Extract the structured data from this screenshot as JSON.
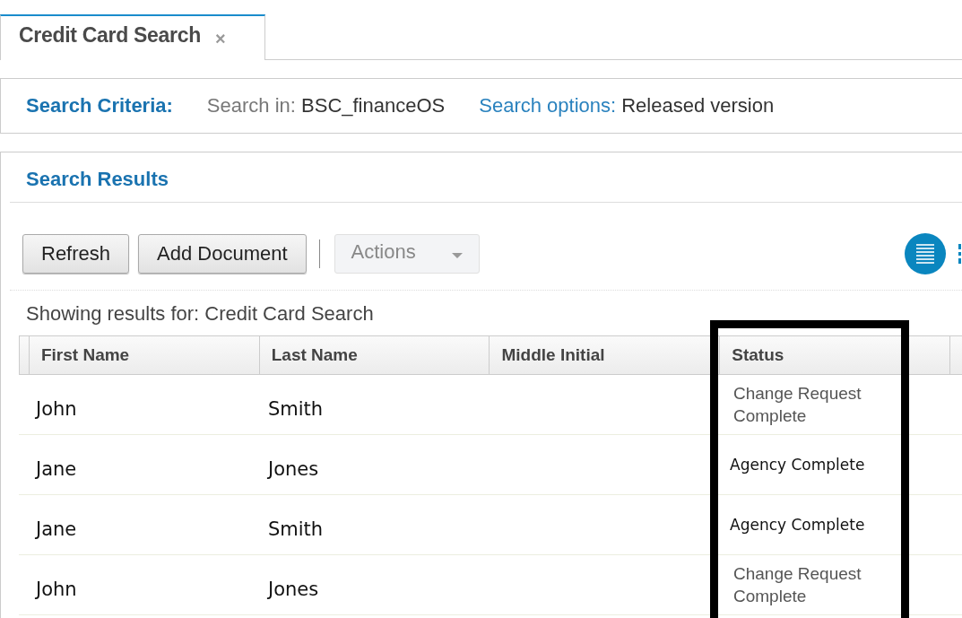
{
  "tabs": [
    {
      "label": "Credit Card Search",
      "selected": true,
      "close": "×"
    }
  ],
  "criteria": {
    "title": "Search Criteria:",
    "search_in_label": "Search in:",
    "search_in_value": "BSC_financeOS",
    "options_label": "Search options:",
    "options_value": "Released version"
  },
  "results": {
    "title": "Search Results",
    "toolbar": [
      {
        "kind": "button",
        "label": "Refresh",
        "disabled": false
      },
      {
        "kind": "button",
        "label": "Add Document",
        "disabled": false
      },
      {
        "kind": "dropdown",
        "label": "Actions",
        "disabled": true
      }
    ],
    "showing": "Showing results for: Credit Card Search",
    "table": {
      "columns": [
        {
          "label": "First Name",
          "highlighted": false
        },
        {
          "label": "Last Name",
          "highlighted": false
        },
        {
          "label": "Middle Initial",
          "highlighted": false
        },
        {
          "label": "Status",
          "highlighted": true
        }
      ],
      "rows": [
        {
          "first": "John",
          "last": "Smith",
          "status": "Change Request Complete",
          "kind": "system"
        },
        {
          "first": "Jane",
          "last": "Jones",
          "status": "Agency Complete",
          "kind": "pasted"
        },
        {
          "first": "Jane",
          "last": "Smith",
          "status": "Agency Complete",
          "kind": "pasted"
        },
        {
          "first": "John",
          "last": "Jones",
          "status": "Change Request Complete",
          "kind": "system"
        }
      ]
    }
  }
}
